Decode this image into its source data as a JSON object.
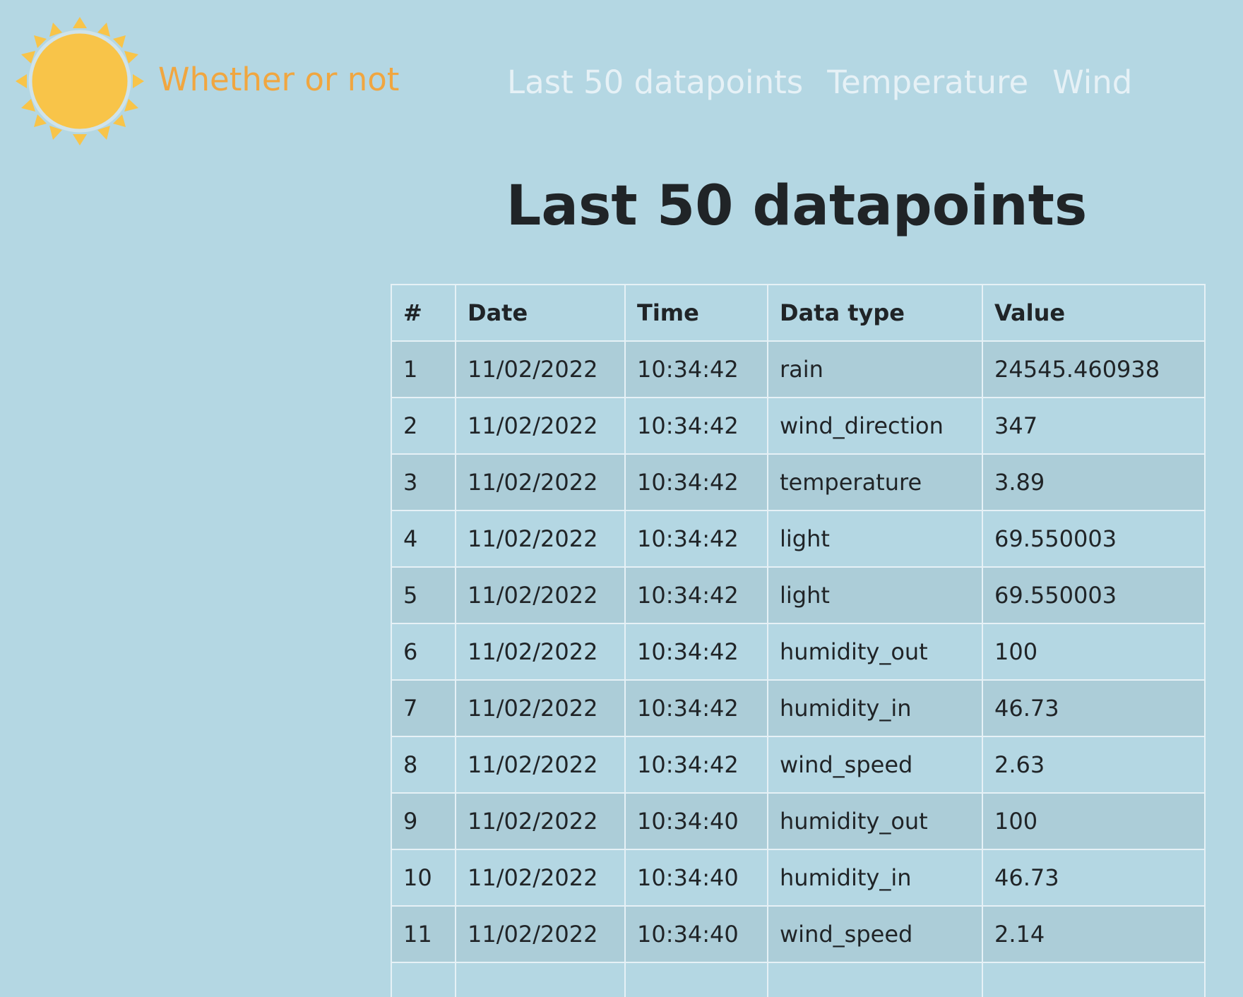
{
  "brand": {
    "name": "Whether or not",
    "color": "#f0a640",
    "logo_icon": "sun-icon"
  },
  "nav": {
    "items": [
      "Last 50 datapoints",
      "Temperature",
      "Wind"
    ]
  },
  "page_title": "Last 50 datapoints",
  "table": {
    "headers": [
      "#",
      "Date",
      "Time",
      "Data type",
      "Value"
    ],
    "rows": [
      [
        "1",
        "11/02/2022",
        "10:34:42",
        "rain",
        "24545.460938"
      ],
      [
        "2",
        "11/02/2022",
        "10:34:42",
        "wind_direction",
        "347"
      ],
      [
        "3",
        "11/02/2022",
        "10:34:42",
        "temperature",
        "3.89"
      ],
      [
        "4",
        "11/02/2022",
        "10:34:42",
        "light",
        "69.550003"
      ],
      [
        "5",
        "11/02/2022",
        "10:34:42",
        "light",
        "69.550003"
      ],
      [
        "6",
        "11/02/2022",
        "10:34:42",
        "humidity_out",
        "100"
      ],
      [
        "7",
        "11/02/2022",
        "10:34:42",
        "humidity_in",
        "46.73"
      ],
      [
        "8",
        "11/02/2022",
        "10:34:42",
        "wind_speed",
        "2.63"
      ],
      [
        "9",
        "11/02/2022",
        "10:34:40",
        "humidity_out",
        "100"
      ],
      [
        "10",
        "11/02/2022",
        "10:34:40",
        "humidity_in",
        "46.73"
      ],
      [
        "11",
        "11/02/2022",
        "10:34:40",
        "wind_speed",
        "2.14"
      ]
    ]
  },
  "colors": {
    "background": "#b4d7e3",
    "stripe": "#accdd8",
    "nav_text": "#e6f1f6",
    "sun": "#f8c449"
  }
}
